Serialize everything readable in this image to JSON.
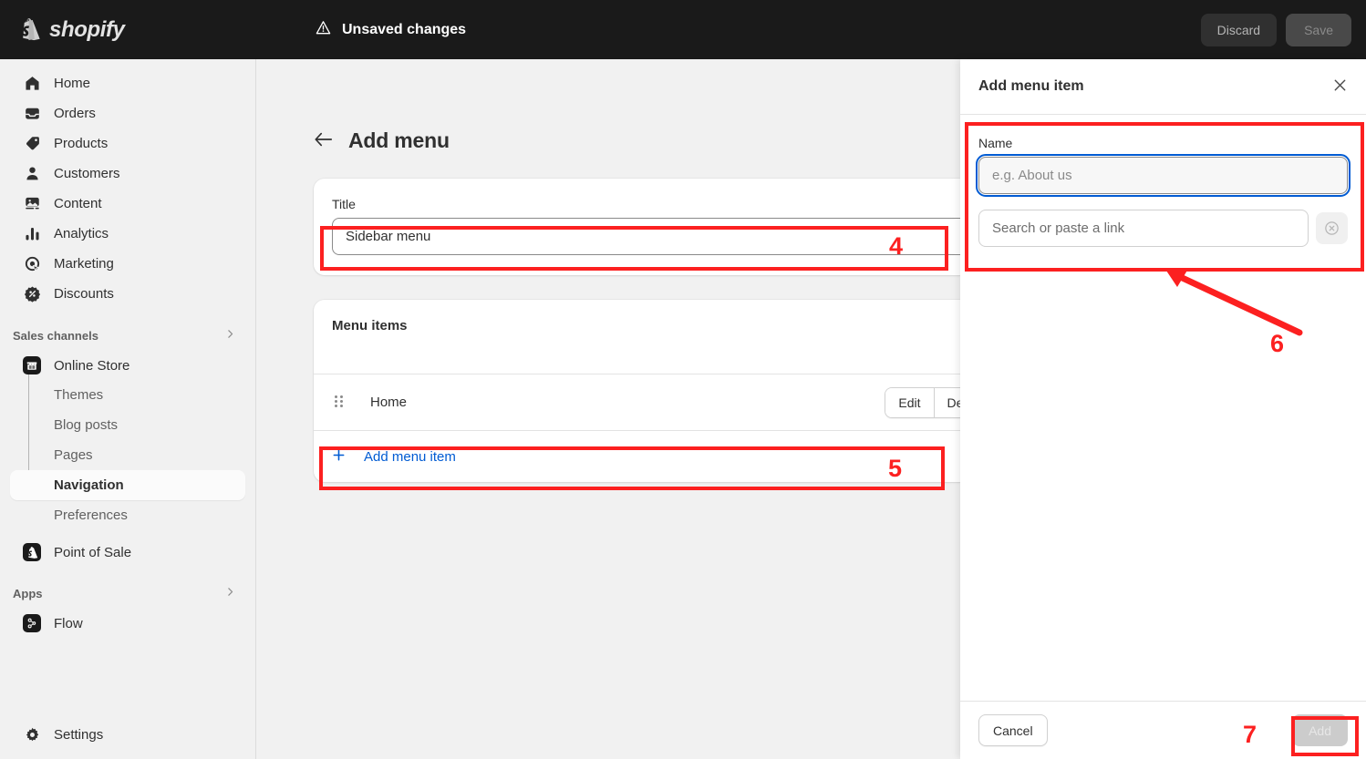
{
  "topbar": {
    "brand": "shopify",
    "brand_icon": "shopify-bag-icon",
    "status_icon": "warning-triangle-icon",
    "status_text": "Unsaved changes",
    "discard_label": "Discard",
    "save_label": "Save"
  },
  "sidebar": {
    "items": [
      {
        "label": "Home",
        "icon": "home-icon"
      },
      {
        "label": "Orders",
        "icon": "orders-inbox-icon"
      },
      {
        "label": "Products",
        "icon": "product-tag-icon"
      },
      {
        "label": "Customers",
        "icon": "person-icon"
      },
      {
        "label": "Content",
        "icon": "content-image-icon"
      },
      {
        "label": "Analytics",
        "icon": "bar-chart-icon"
      },
      {
        "label": "Marketing",
        "icon": "marketing-target-icon"
      },
      {
        "label": "Discounts",
        "icon": "discount-badge-icon"
      }
    ],
    "sales_channels": {
      "label": "Sales channels",
      "chevron": "chevron-right-icon",
      "online_store": {
        "label": "Online Store",
        "icon": "storefront-icon"
      },
      "sub_items": [
        {
          "label": "Themes",
          "active": false
        },
        {
          "label": "Blog posts",
          "active": false
        },
        {
          "label": "Pages",
          "active": false
        },
        {
          "label": "Navigation",
          "active": true
        },
        {
          "label": "Preferences",
          "active": false
        }
      ],
      "point_of_sale": {
        "label": "Point of Sale",
        "icon": "shopify-bag-icon"
      }
    },
    "apps": {
      "label": "Apps",
      "chevron": "chevron-right-icon",
      "items": [
        {
          "label": "Flow",
          "icon": "flow-nodes-icon"
        }
      ]
    },
    "settings": {
      "label": "Settings",
      "icon": "gear-icon"
    }
  },
  "main": {
    "back_icon": "arrow-left-icon",
    "page_title": "Add menu",
    "title_card": {
      "field_label": "Title",
      "title_value": "Sidebar menu"
    },
    "menu_items_card": {
      "heading": "Menu items",
      "rows": [
        {
          "label": "Home",
          "drag_icon": "drag-handle-icon",
          "edit_label": "Edit",
          "delete_label": "Delete"
        }
      ],
      "add_row": {
        "plus_icon": "plus-icon",
        "label": "Add menu item"
      }
    }
  },
  "panel": {
    "title": "Add menu item",
    "close_icon": "close-icon",
    "name_label": "Name",
    "name_value": "",
    "name_placeholder": "e.g. About us",
    "link_value": "",
    "link_placeholder": "Search or paste a link",
    "clear_icon": "circle-x-icon",
    "cancel_label": "Cancel",
    "add_label": "Add"
  },
  "annotations": {
    "color": "#fc2020",
    "numbers": [
      {
        "id": "4",
        "label": "4"
      },
      {
        "id": "5",
        "label": "5"
      },
      {
        "id": "6",
        "label": "6"
      },
      {
        "id": "7",
        "label": "7"
      }
    ]
  }
}
